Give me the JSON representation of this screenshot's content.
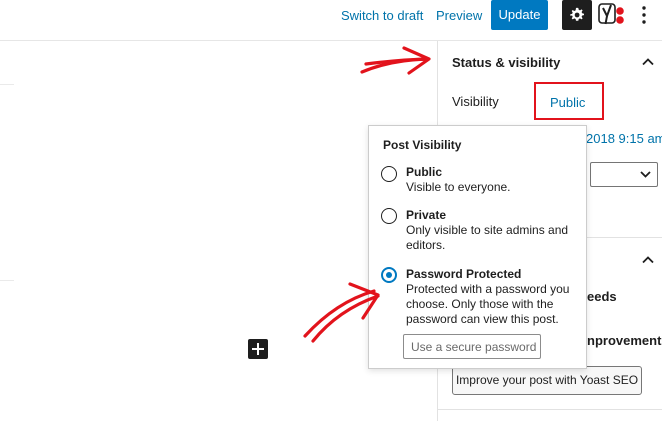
{
  "header": {
    "switch_to_draft": "Switch to draft",
    "preview": "Preview",
    "update": "Update",
    "icons": [
      "gear-icon",
      "yoast-icon",
      "more-vertical-icon"
    ]
  },
  "sidebar": {
    "panel_title": "Status & visibility",
    "visibility_label": "Visibility",
    "visibility_value": "Public",
    "publish_date": "2018 9:15 am",
    "yoast_fragment_1": "eeds",
    "yoast_fragment_2": "nprovement",
    "yoast_button": "Improve your post with Yoast SEO"
  },
  "popover": {
    "title": "Post Visibility",
    "options": [
      {
        "label": "Public",
        "description": "Visible to everyone.",
        "checked": false
      },
      {
        "label": "Private",
        "description": "Only visible to site admins and editors.",
        "checked": false
      },
      {
        "label": "Password Protected",
        "description": "Protected with a password you choose. Only those with the password can view this post.",
        "checked": true
      }
    ],
    "password_placeholder": "Use a secure password"
  },
  "colors": {
    "accent": "#0079c1",
    "link": "#0073aa",
    "annotation": "#e2131c",
    "dark": "#1e1e1e"
  }
}
